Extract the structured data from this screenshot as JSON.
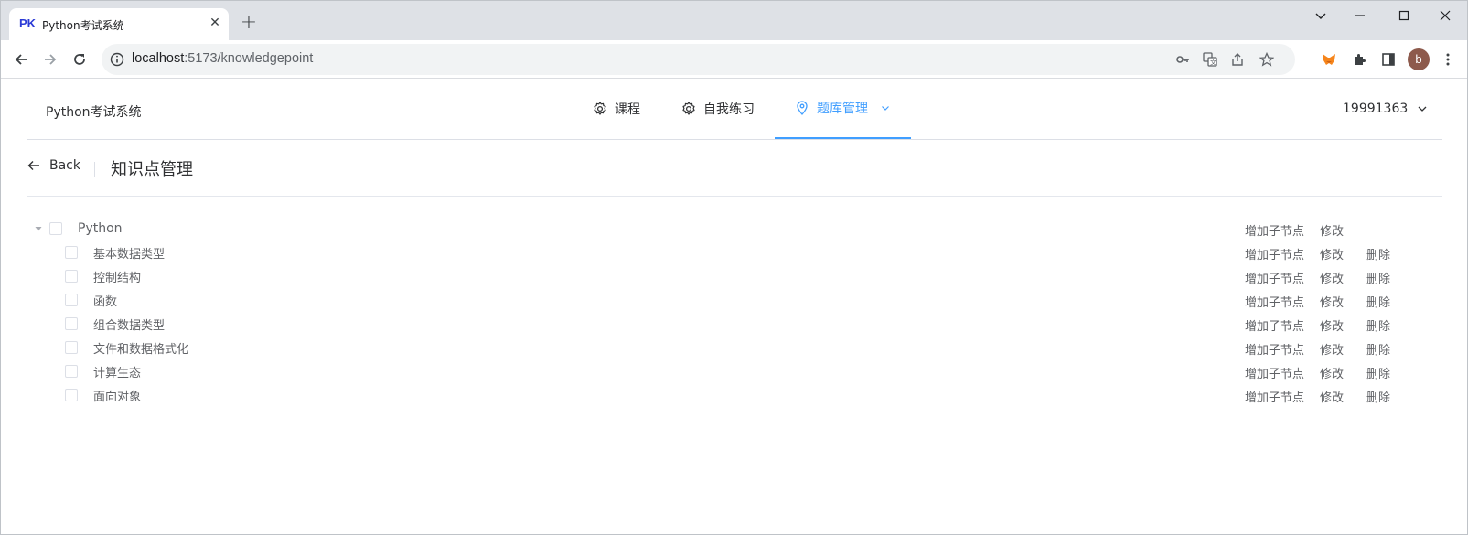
{
  "browser": {
    "tab": {
      "favicon_text": "PK",
      "title": "Python考试系统",
      "close": "✕"
    },
    "new_tab": "+",
    "url": {
      "host": "localhost",
      "rest": ":5173/knowledgepoint"
    },
    "avatar_letter": "b"
  },
  "app": {
    "brand": "Python考试系统",
    "menu": [
      {
        "label": "课程",
        "icon": "gear-icon"
      },
      {
        "label": "自我练习",
        "icon": "gear-icon"
      },
      {
        "label": "题库管理",
        "icon": "location-icon",
        "active": true
      }
    ],
    "user": "19991363"
  },
  "page": {
    "back_label": "Back",
    "title": "知识点管理"
  },
  "tree": {
    "root": {
      "label": "Python",
      "actions": [
        "增加子节点",
        "修改"
      ]
    },
    "children": [
      {
        "label": "基本数据类型",
        "actions": [
          "增加子节点",
          "修改",
          "删除"
        ]
      },
      {
        "label": "控制结构",
        "actions": [
          "增加子节点",
          "修改",
          "删除"
        ]
      },
      {
        "label": "函数",
        "actions": [
          "增加子节点",
          "修改",
          "删除"
        ]
      },
      {
        "label": "组合数据类型",
        "actions": [
          "增加子节点",
          "修改",
          "删除"
        ]
      },
      {
        "label": "文件和数据格式化",
        "actions": [
          "增加子节点",
          "修改",
          "删除"
        ]
      },
      {
        "label": "计算生态",
        "actions": [
          "增加子节点",
          "修改",
          "删除"
        ]
      },
      {
        "label": "面向对象",
        "actions": [
          "增加子节点",
          "修改",
          "删除"
        ]
      }
    ]
  },
  "colors": {
    "accent": "#409eff",
    "text": "#303133",
    "muted": "#606266"
  }
}
